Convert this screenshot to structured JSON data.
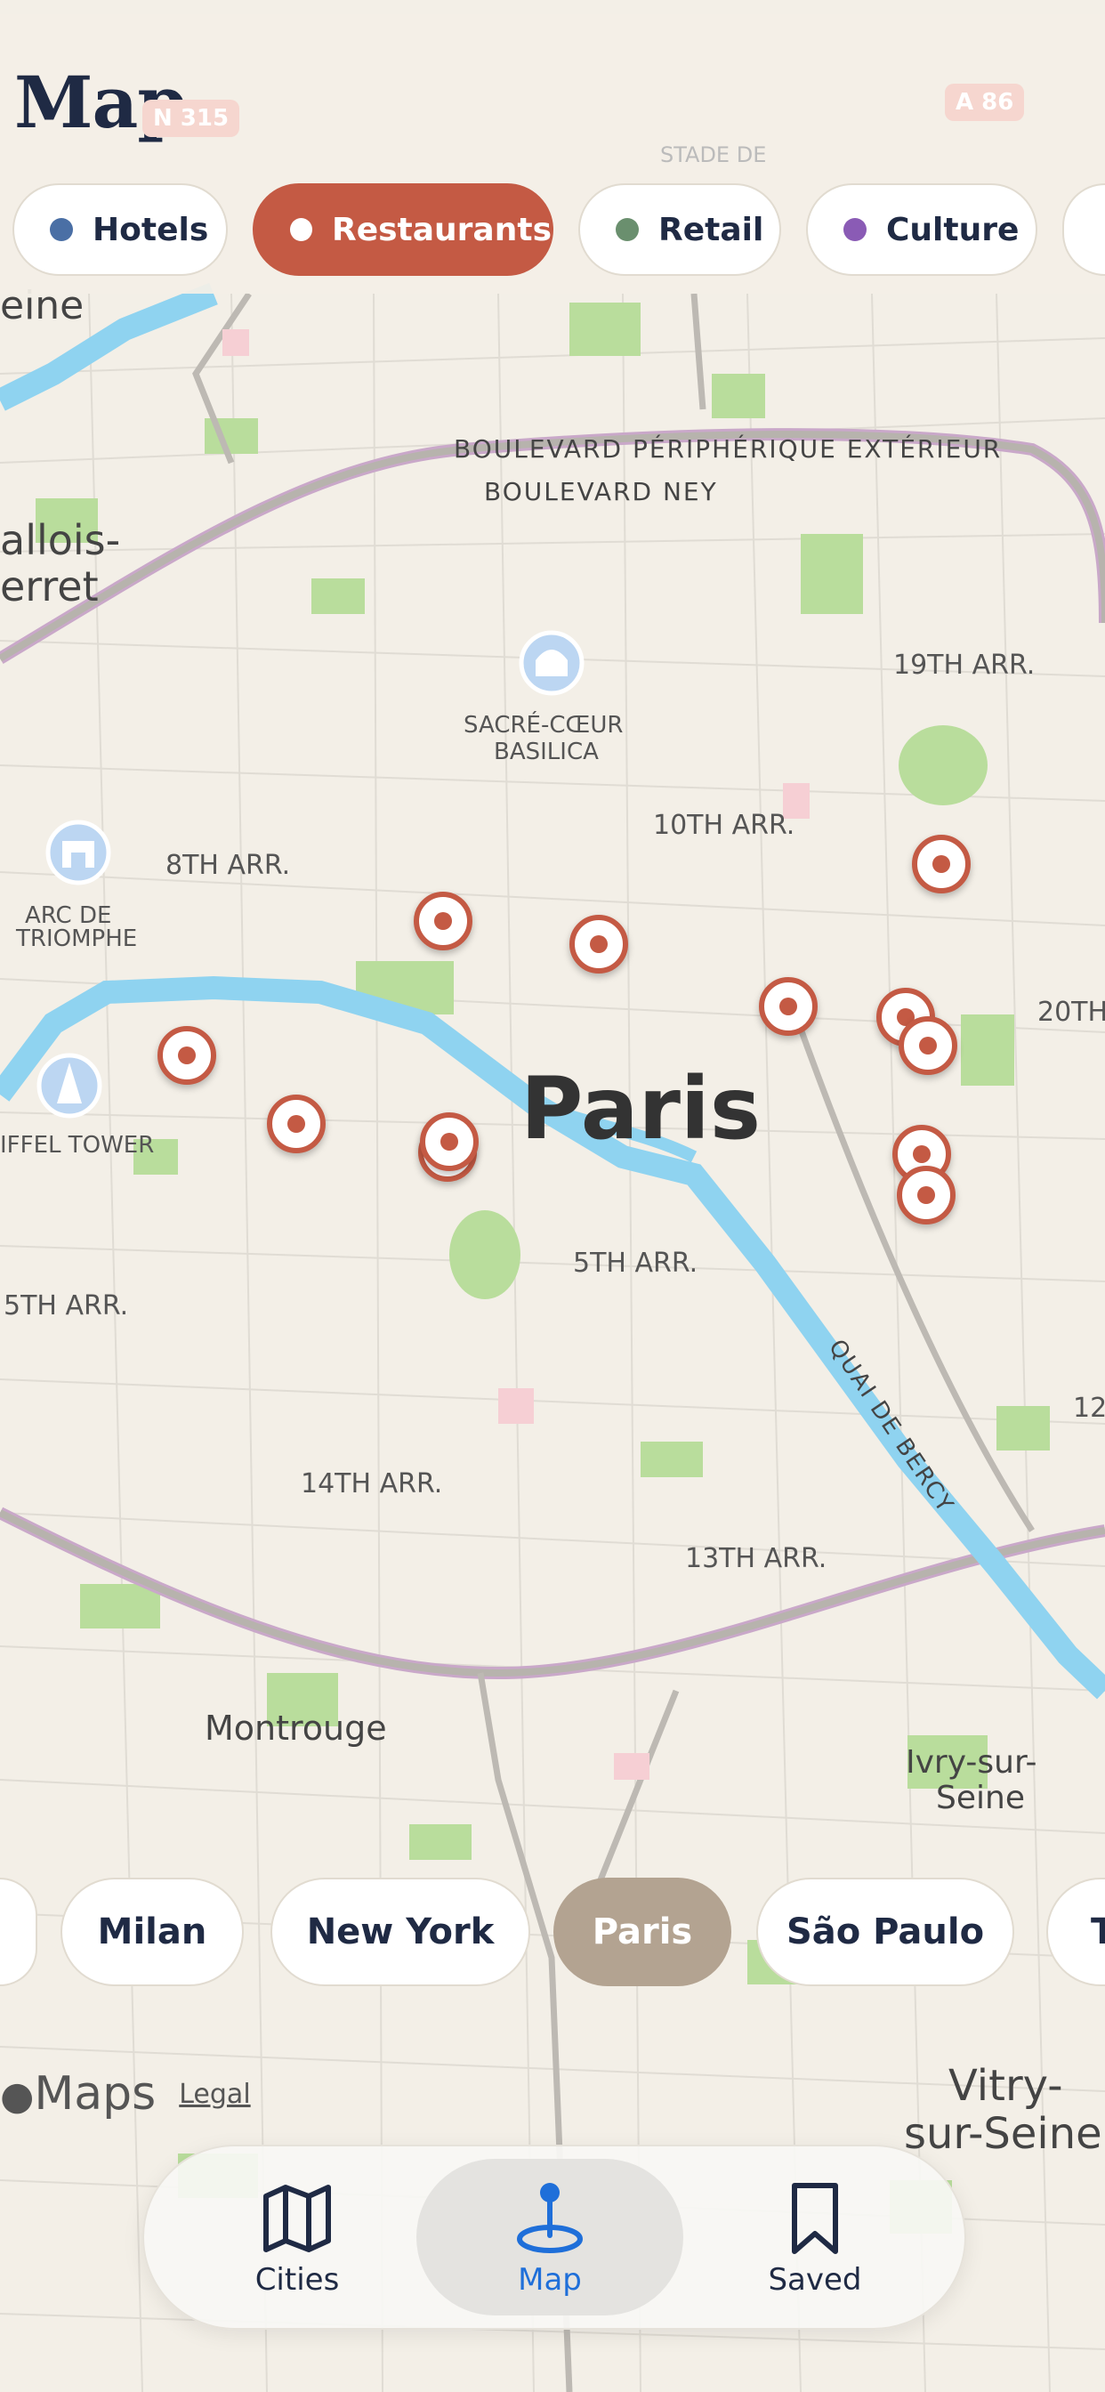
{
  "header": {
    "title": "Map"
  },
  "filters": [
    {
      "label": "Hotels",
      "dot_color": "#4a6fa5",
      "active": false
    },
    {
      "label": "Restaurants",
      "dot_color": "#ffffff",
      "active": true
    },
    {
      "label": "Retail",
      "dot_color": "#6a8f6e",
      "active": false
    },
    {
      "label": "Culture",
      "dot_color": "#8a5bb5",
      "active": false
    }
  ],
  "map": {
    "city_label": "Paris",
    "landmarks": [
      "SACRÉ-CŒUR",
      "BASILICA",
      "ARC DE",
      "TRIOMPHE",
      "IFFEL TOWER"
    ],
    "districts": [
      "8TH ARR.",
      "10TH ARR.",
      "19TH ARR.",
      "20TH",
      "5TH ARR.",
      "5TH ARR.",
      "14TH ARR.",
      "13TH ARR.",
      "12"
    ],
    "roads": [
      "BOULEVARD PÉRIPHÉRIQUE EXTÉRIEUR",
      "BOULEVARD NEY",
      "QUAI DE BERCY"
    ],
    "places": [
      "allois-",
      "erret",
      "Montrouge",
      "Ivry-sur-",
      "Seine",
      "Vitry-",
      "sur-Seine",
      "eine",
      "STADE DE",
      "N 315",
      "A 86"
    ],
    "pin_count": 12
  },
  "cities": [
    "",
    "Milan",
    "New York",
    "Paris",
    "São Paulo",
    "T"
  ],
  "selected_city": "Paris",
  "attribution": {
    "maps": "Maps",
    "legal": "Legal"
  },
  "tabbar": {
    "tabs": [
      {
        "label": "Cities",
        "icon": "map-icon",
        "active": false
      },
      {
        "label": "Map",
        "icon": "location-pin-icon",
        "active": true
      },
      {
        "label": "Saved",
        "icon": "bookmark-icon",
        "active": false
      }
    ]
  },
  "colors": {
    "accent": "#c45a44",
    "selected_city": "#b3a391",
    "active_tab": "#1f6fd9",
    "text": "#1f2a44"
  }
}
